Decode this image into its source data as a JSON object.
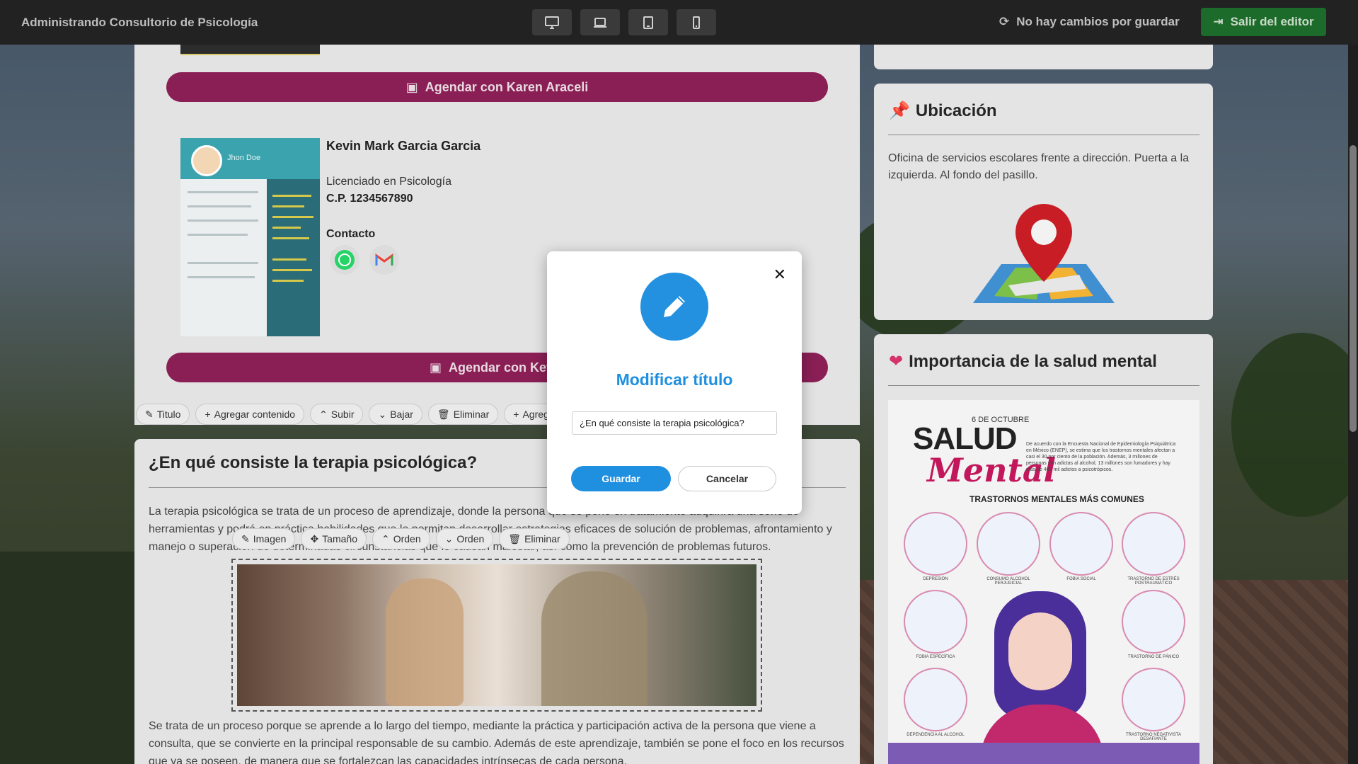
{
  "app": {
    "title": "Administrando Consultorio de Psicología",
    "status": "No hay cambios por guardar",
    "exit_label": "Salir del editor",
    "view_modes": [
      "desktop-icon",
      "laptop-icon",
      "tablet-icon",
      "mobile-icon"
    ]
  },
  "therapists": {
    "schedule_karen": "Agendar con Karen Araceli",
    "schedule_kevin": "Agendar con Kevin",
    "kevin": {
      "name": "Kevin Mark Garcia Garcia",
      "degree": "Licenciado en Psicología",
      "license": "C.P. 1234567890",
      "contact_label": "Contacto",
      "cv_name": "Jhon Doe"
    }
  },
  "section_toolbar": [
    "Titulo",
    "Agregar contenido",
    "Subir",
    "Bajar",
    "Eliminar",
    "Agreg"
  ],
  "image_toolbar": [
    "Imagen",
    "Tamaño",
    "Orden",
    "Orden",
    "Eliminar"
  ],
  "section": {
    "title": "¿En qué consiste la terapia psicológica?",
    "paragraph1": "La terapia psicológica se trata de un proceso de aprendizaje, donde la persona que se pone en tratamiento adquirirá una serie de herramientas y podrá en práctica habilidades que le permitan desarrollar estrategias eficaces de solución de problemas, afrontamiento y manejo o superación de determinadas circunstancias que le causan malestar, así como la prevención de problemas futuros.",
    "paragraph2": "Se trata de un proceso porque se aprende a lo largo del tiempo, mediante la práctica y participación activa de la persona que viene a consulta, que se convierte en la principal responsable de su cambio. Además de este aprendizaje, también se pone el foco en los recursos que ya se poseen, de manera que se fortalezcan las capacidades intrínsecas de cada persona."
  },
  "location": {
    "title": "Ubicación",
    "text": "Oficina de servicios escolares frente a dirección. Puerta a la izquierda. Al fondo del pasillo."
  },
  "mental_health": {
    "title": "Importancia de la salud mental",
    "poster": {
      "date": "6 DE OCTUBRE",
      "word1": "SALUD",
      "word2": "Mental",
      "subtitle": "TRASTORNOS MENTALES MÁS COMUNES",
      "blurb": "De acuerdo con la Encuesta Nacional de Epidemiología Psiquiátrica en México (ENEP), se estima que los trastornos mentales afectan a casi el 30 por ciento de la población. Además, 3 millones de personas son adictas al alcohol, 13 millones son fumadores y hay más de 400 mil adictos a psicotrópicos.",
      "disorders": [
        "DEPRESIÓN",
        "CONSUMO ALCOHOL PERJUDICIAL",
        "FOBIA SOCIAL",
        "TRASTORNO DE ESTRÉS POSTRAUMÁTICO",
        "FOBIA ESPECÍFICA",
        "TRASTORNO DE PÁNICO",
        "DEPENDENCIA AL ALCOHOL",
        "TRASTORNO NEGATIVISTA DESAFIANTE"
      ]
    }
  },
  "modal": {
    "title": "Modificar título",
    "input_value": "¿En qué consiste la terapia psicológica?",
    "save_label": "Guardar",
    "cancel_label": "Cancelar",
    "close_glyph": "✕"
  },
  "colors": {
    "accent_blue": "#1f8fe0",
    "schedule_button": "#8a1f55",
    "exit_button": "#1d6b2a",
    "topbar": "#222222"
  }
}
